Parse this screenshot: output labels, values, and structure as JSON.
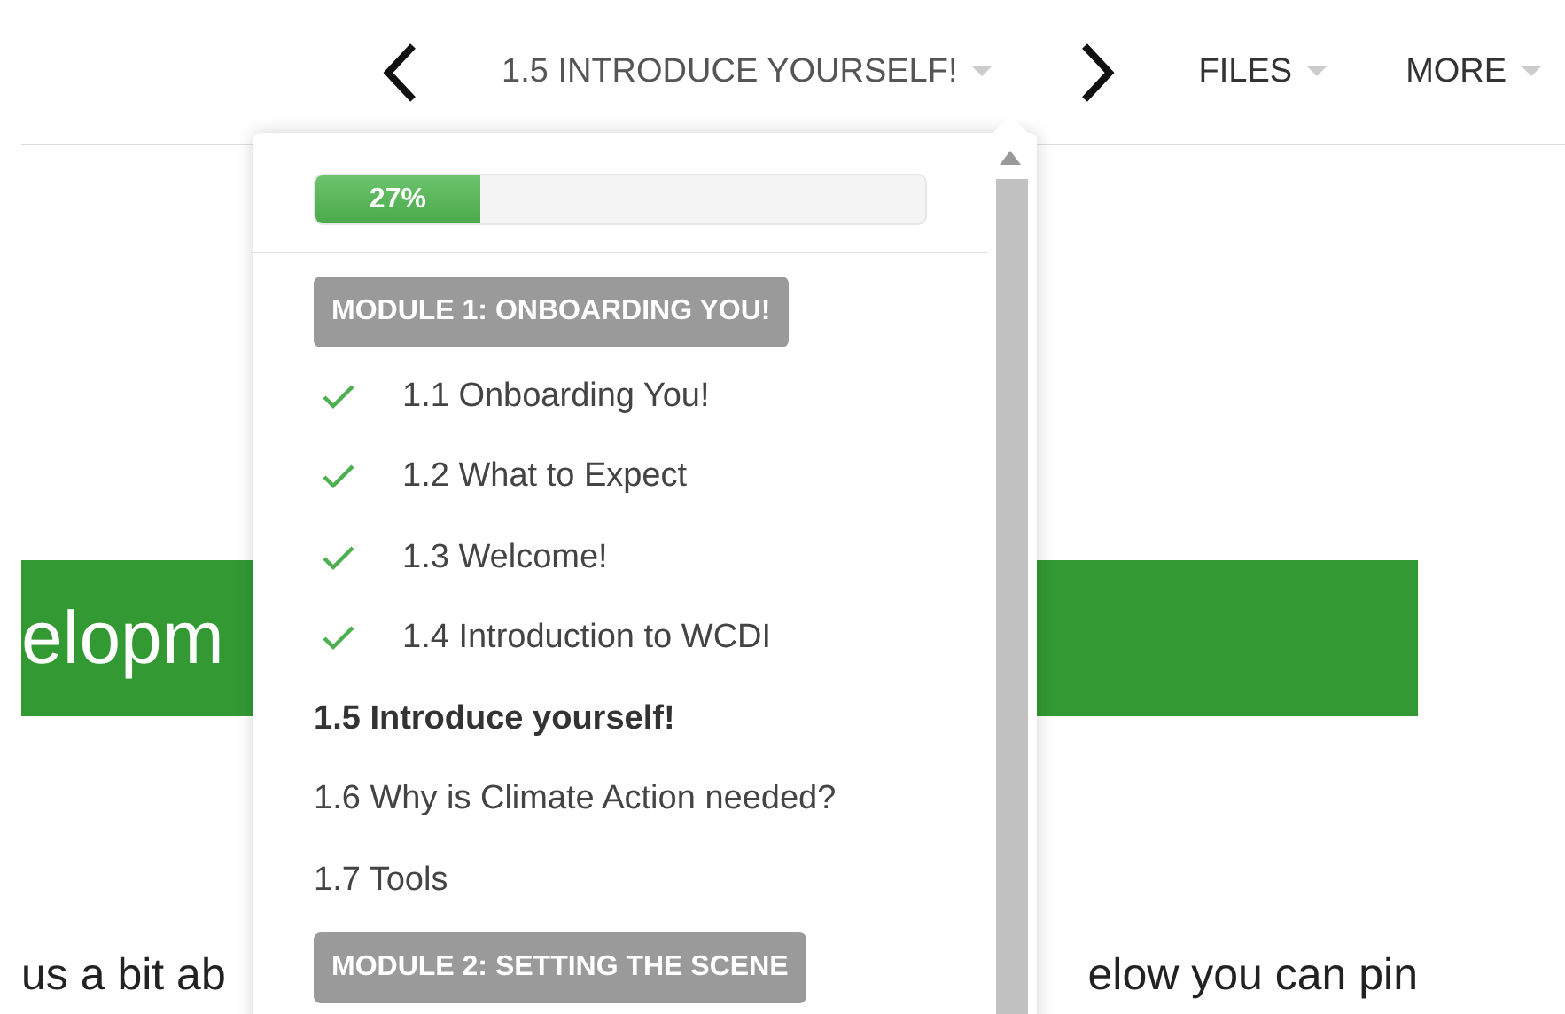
{
  "nav": {
    "current_lesson": "1.5 INTRODUCE YOURSELF!",
    "menus": [
      "FILES",
      "MORE"
    ]
  },
  "page": {
    "banner_text": "elopm",
    "body_left": "us a bit ab",
    "body_right": "elow you can pin"
  },
  "outline": {
    "progress": {
      "level": 0.27,
      "label": "27%"
    },
    "items": [
      {
        "kind": "module",
        "label": "MODULE 1: ONBOARDING YOU!"
      },
      {
        "kind": "lesson",
        "label": "1.1 Onboarding You!",
        "completed": true,
        "selected": false
      },
      {
        "kind": "lesson",
        "label": "1.2 What to Expect",
        "completed": true,
        "selected": false
      },
      {
        "kind": "lesson",
        "label": "1.3 Welcome!",
        "completed": true,
        "selected": false
      },
      {
        "kind": "lesson",
        "label": "1.4 Introduction to WCDI",
        "completed": true,
        "selected": false
      },
      {
        "kind": "lesson",
        "label": "1.5 Introduce yourself!",
        "completed": false,
        "selected": true
      },
      {
        "kind": "lesson",
        "label": "1.6 Why is Climate Action needed?",
        "completed": false,
        "selected": false
      },
      {
        "kind": "lesson",
        "label": "1.7 Tools",
        "completed": false,
        "selected": false
      },
      {
        "kind": "module",
        "label": "MODULE 2: SETTING THE SCENE"
      }
    ]
  }
}
